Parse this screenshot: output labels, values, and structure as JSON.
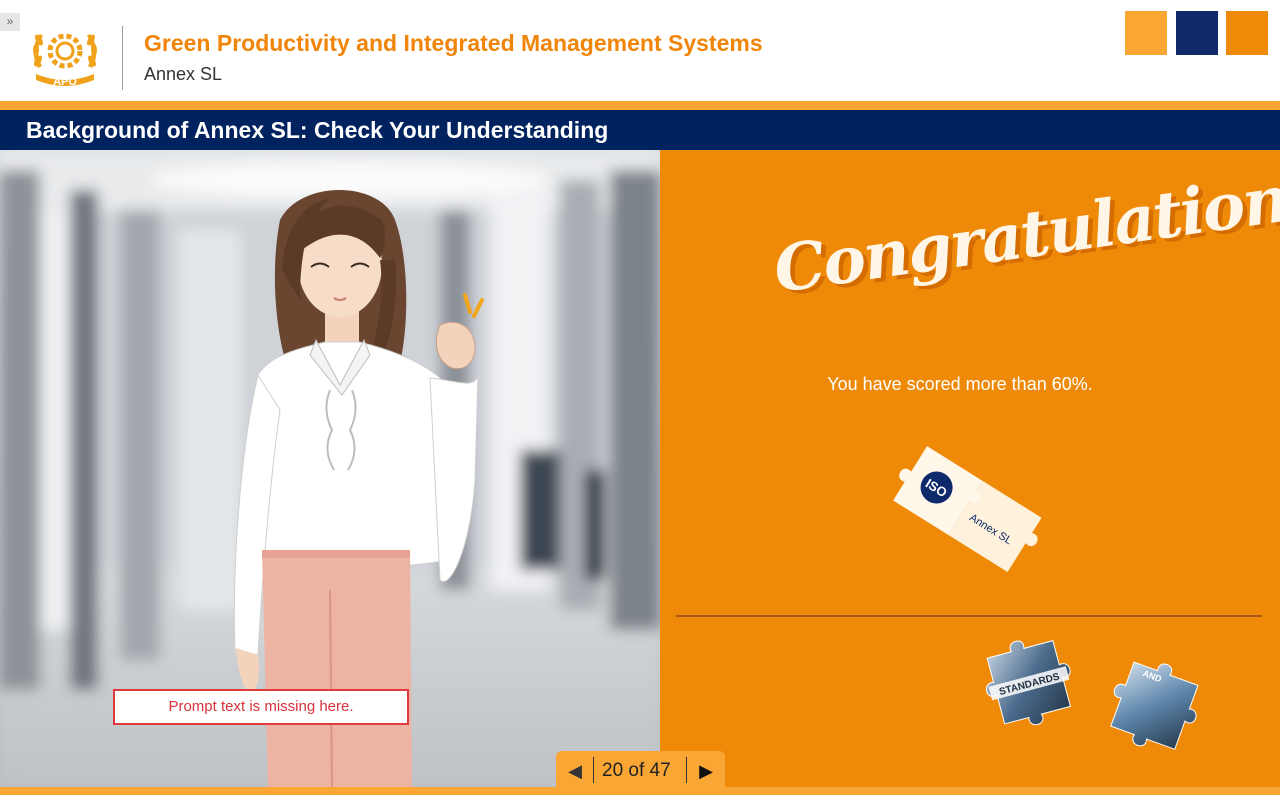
{
  "header": {
    "expand_glyph": "»",
    "logo_text": "APO",
    "course_title": "Green Productivity and Integrated Management Systems",
    "course_subtitle": "Annex SL"
  },
  "slide": {
    "title": "Background of Annex SL: Check Your Understanding",
    "prompt_text": "Prompt text is missing here."
  },
  "result": {
    "congrats": "Congratulations",
    "score_message": "You have scored more than 60%.",
    "puzzle_left_label": "ISO",
    "puzzle_right_label": "Annex SL",
    "piece1_label": "STANDARDS",
    "piece2_label": "AND"
  },
  "nav": {
    "prev_glyph": "◀",
    "counter": "20 of 47",
    "next_glyph": "▶"
  },
  "colors": {
    "brand_orange": "#ef8a08",
    "accent_orange": "#f9a634",
    "navy": "#00235f",
    "prompt_red": "#e0393e"
  }
}
